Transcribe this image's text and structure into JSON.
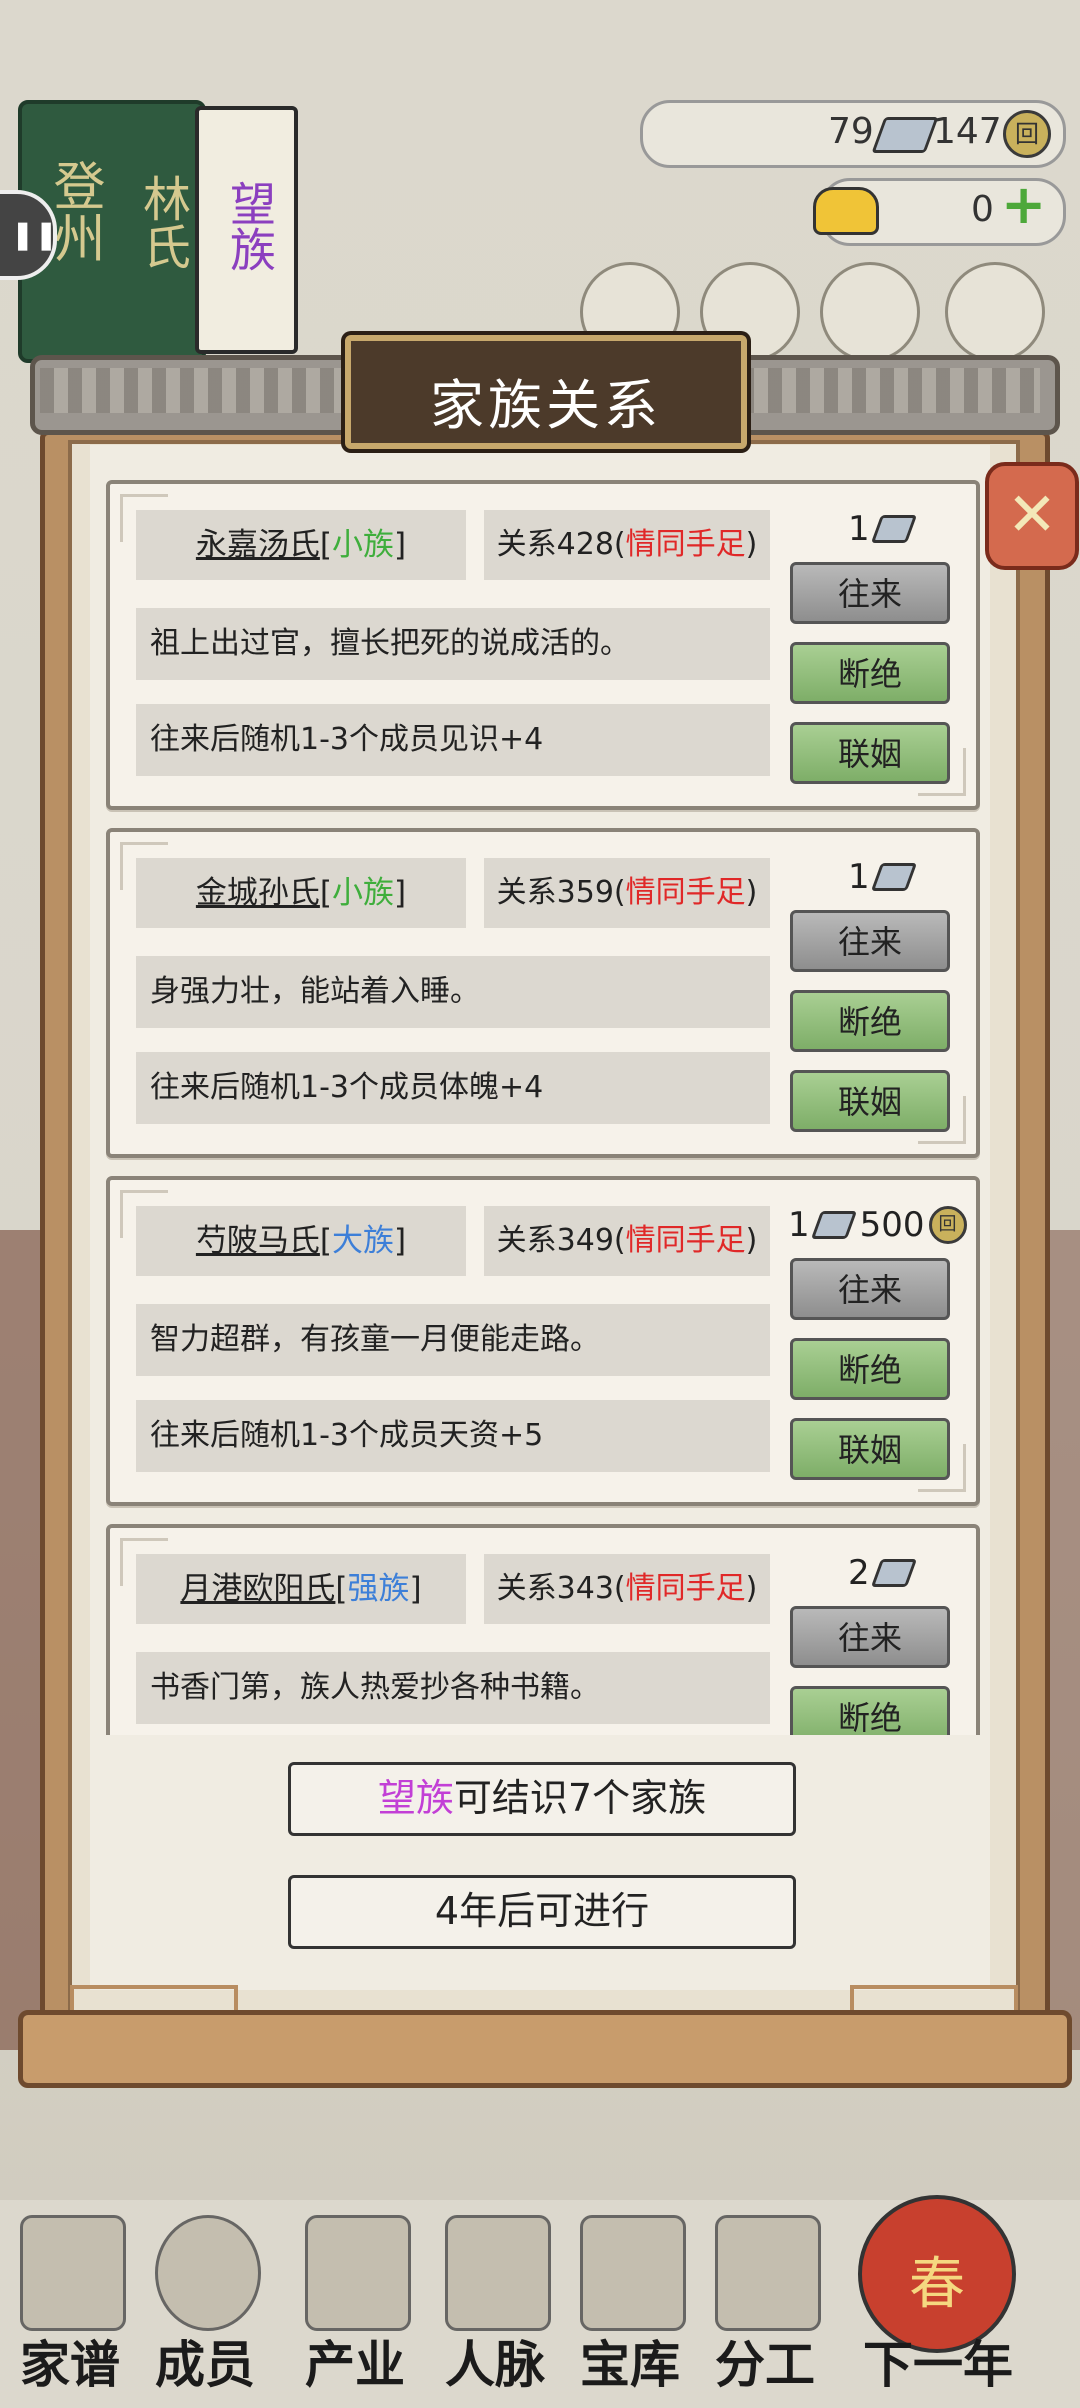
{
  "header": {
    "book_region": "登州",
    "book_family": "林氏",
    "book_rank": "望族",
    "silver_count": "79",
    "copper_count": "147",
    "gold_count": "0",
    "coin_glyph": "回",
    "plus_glyph": "+",
    "pause_glyph": "❚❚"
  },
  "dialog": {
    "title": "家族关系",
    "close_glyph": "✕",
    "families": [
      {
        "name": "永嘉汤氏",
        "rank": "小族",
        "rank_color": "#3fae3c",
        "relation_prefix": "关系428(",
        "relation_label": "情同手足",
        "relation_suffix": ")",
        "desc": "祖上出过官，擅长把死的说成活的。",
        "effect": "往来后随机1-3个成员见识+4",
        "cost_silver": "1",
        "cost_copper": "",
        "btn_visit": "往来",
        "btn_break": "断绝",
        "btn_marry": "联姻"
      },
      {
        "name": "金城孙氏",
        "rank": "小族",
        "rank_color": "#3fae3c",
        "relation_prefix": "关系359(",
        "relation_label": "情同手足",
        "relation_suffix": ")",
        "desc": "身强力壮，能站着入睡。",
        "effect": "往来后随机1-3个成员体魄+4",
        "cost_silver": "1",
        "cost_copper": "",
        "btn_visit": "往来",
        "btn_break": "断绝",
        "btn_marry": "联姻"
      },
      {
        "name": "芍陂马氏",
        "rank": "大族",
        "rank_color": "#3d7fd8",
        "relation_prefix": "关系349(",
        "relation_label": "情同手足",
        "relation_suffix": ")",
        "desc": "智力超群，有孩童一月便能走路。",
        "effect": "往来后随机1-3个成员天资+5",
        "cost_silver": "1",
        "cost_copper": "500",
        "btn_visit": "往来",
        "btn_break": "断绝",
        "btn_marry": "联姻"
      },
      {
        "name": "月港欧阳氏",
        "rank": "强族",
        "rank_color": "#3d7fd8",
        "relation_prefix": "关系343(",
        "relation_label": "情同手足",
        "relation_suffix": ")",
        "desc": "书香门第，族人热爱抄各种书籍。",
        "effect": "",
        "cost_silver": "2",
        "cost_copper": "",
        "btn_visit": "往来",
        "btn_break": "断绝",
        "btn_marry": ""
      }
    ],
    "info_rank": "望族",
    "info_text": "可结识7个家族",
    "wait_text": "4年后可进行"
  },
  "nav": [
    {
      "label": "家谱",
      "icon": "genealogy-icon"
    },
    {
      "label": "成员",
      "icon": "member-icon"
    },
    {
      "label": "产业",
      "icon": "property-icon"
    },
    {
      "label": "人脉",
      "icon": "network-icon"
    },
    {
      "label": "宝库",
      "icon": "treasury-icon"
    },
    {
      "label": "分工",
      "icon": "division-icon"
    },
    {
      "label": "下一年",
      "icon": "next-year-icon"
    }
  ],
  "nav_lantern_glyph": "春",
  "colors": {
    "relation_red": "#e02828",
    "rank_purple": "#c23fd6",
    "button_green": "#8fbe78",
    "button_gray": "#a8a8a8"
  }
}
